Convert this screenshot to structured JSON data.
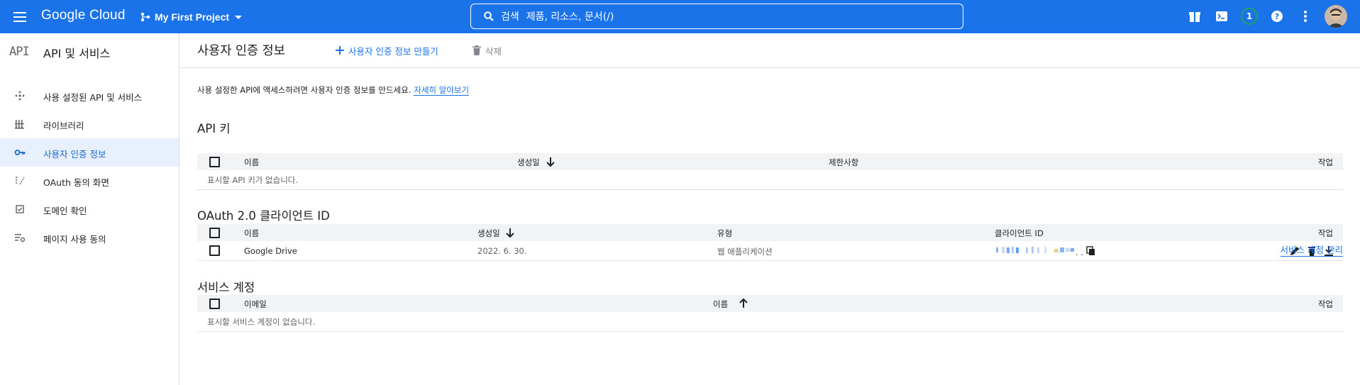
{
  "topbar": {
    "logo": "Google Cloud",
    "project": "My First Project",
    "search_label": "검색",
    "search_hint": "제품, 리소스, 문서(/)",
    "notification_count": "1",
    "accent": "#1a73e8"
  },
  "sidebar": {
    "icon_text": "API",
    "title": "API 및 서비스",
    "items": [
      {
        "label": "사용 설정된 API 및 서비스",
        "icon": "hub-icon"
      },
      {
        "label": "라이브러리",
        "icon": "library-icon"
      },
      {
        "label": "사용자 인증 정보",
        "icon": "key-icon",
        "active": true
      },
      {
        "label": "OAuth 동의 화면",
        "icon": "consent-icon"
      },
      {
        "label": "도메인 확인",
        "icon": "checkbox-icon"
      },
      {
        "label": "페이지 사용 동의",
        "icon": "settings-list-icon"
      }
    ]
  },
  "header": {
    "title": "사용자 인증 정보",
    "create_label": "사용자 인증 정보 만들기",
    "delete_label": "삭제"
  },
  "intro": {
    "text": "사용 설정한 API에 액세스하려면 사용자 인증 정보를 만드세요.",
    "link": "자세히 알아보기"
  },
  "api_keys": {
    "title": "API 키",
    "columns": [
      "이름",
      "생성일",
      "제한사항",
      "작업"
    ],
    "empty": "표시할 API 키가 없습니다."
  },
  "oauth": {
    "title": "OAuth 2.0 클라이언트 ID",
    "columns": [
      "이름",
      "생성일",
      "유형",
      "클라이언트 ID",
      "작업"
    ],
    "rows": [
      {
        "name": "Google Drive",
        "created": "2022. 6. 30.",
        "type": "웹 애플리케이션",
        "client_id_suffix": ". ."
      }
    ]
  },
  "service_accounts": {
    "title": "서비스 계정",
    "manage_link": "서비스 계정 관리",
    "columns": [
      "이메일",
      "이름",
      "작업"
    ],
    "empty": "표시할 서비스 계정이 없습니다."
  }
}
